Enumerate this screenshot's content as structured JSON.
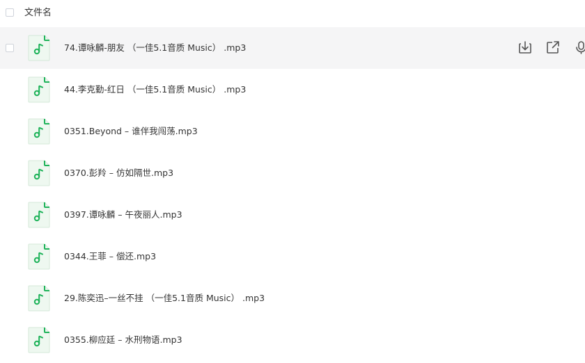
{
  "header": {
    "column_label": "文件名"
  },
  "files": [
    {
      "name": "74.谭咏麟-朋友 （一佳5.1音质 Music） .mp3",
      "hovered": true
    },
    {
      "name": "44.李克勤-红日 （一佳5.1音质 Music） .mp3"
    },
    {
      "name": "0351.Beyond – 谁伴我闯荡.mp3"
    },
    {
      "name": "0370.彭羚 – 仿如隔世.mp3"
    },
    {
      "name": "0397.谭咏麟 – 午夜丽人.mp3"
    },
    {
      "name": "0344.王菲 – 偿还.mp3"
    },
    {
      "name": "29.陈奕迅–一丝不挂 （一佳5.1音质 Music） .mp3"
    },
    {
      "name": "0355.柳应廷 – 水刑物语.mp3"
    }
  ],
  "row_actions": [
    "download-icon",
    "share-icon",
    "microphone-icon"
  ],
  "colors": {
    "accent": "#1fb35a",
    "icon_bg": "#eef8f0",
    "hover_bg": "#f5f5f6"
  }
}
